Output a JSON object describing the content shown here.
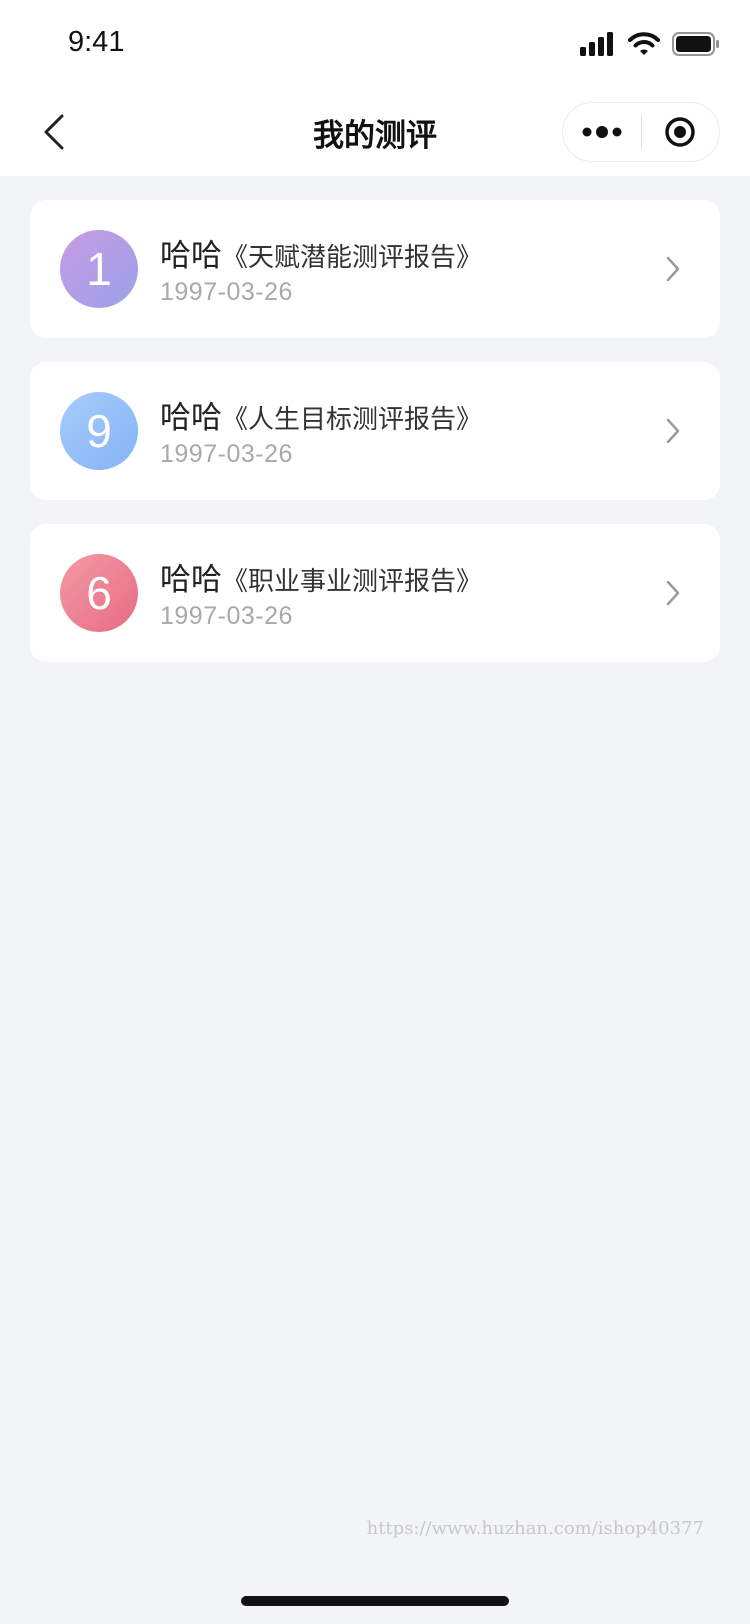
{
  "status_bar": {
    "time": "9:41"
  },
  "nav": {
    "title": "我的测评",
    "icons": {
      "back": "chevron-left-icon",
      "more": "more-dots-icon",
      "close": "target-close-icon"
    }
  },
  "items": [
    {
      "badge": "1",
      "name": "哈哈",
      "report": "《天赋潜能测评报告》",
      "date": "1997-03-26",
      "badge_color_from": "#c79be3",
      "badge_color_to": "#9aa2ea"
    },
    {
      "badge": "9",
      "name": "哈哈",
      "report": "《人生目标测评报告》",
      "date": "1997-03-26",
      "badge_color_from": "#a6cdfb",
      "badge_color_to": "#86b2f6"
    },
    {
      "badge": "6",
      "name": "哈哈",
      "report": "《职业事业测评报告》",
      "date": "1997-03-26",
      "badge_color_from": "#f29aa6",
      "badge_color_to": "#e86c83"
    }
  ],
  "watermark": "https://www.huzhan.com/ishop40377"
}
